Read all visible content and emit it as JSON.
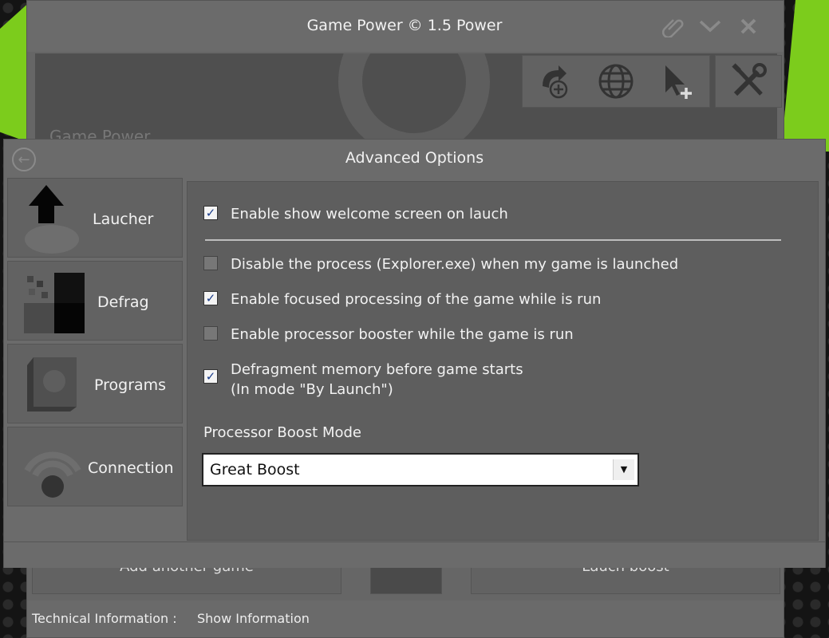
{
  "app": {
    "title": "Game Power © 1.5 Power",
    "banner_text": "Game Power"
  },
  "toolbar": {
    "icons": [
      "refresh-add-icon",
      "globe-icon",
      "cursor-add-icon",
      "tools-icon"
    ]
  },
  "window_controls": {
    "icons": [
      "attach-icon",
      "minimize-icon",
      "close-icon"
    ]
  },
  "bottom": {
    "add_game_label": "Add another game",
    "launch_boost_label": "Lauch boost"
  },
  "status": {
    "label": "Technical Information :",
    "link": "Show Information"
  },
  "dialog": {
    "title": "Advanced Options",
    "sidebar": [
      {
        "label": "Laucher",
        "icon": "launcher-arrow-icon"
      },
      {
        "label": "Defrag",
        "icon": "defrag-blocks-icon"
      },
      {
        "label": "Programs",
        "icon": "programs-box-icon"
      },
      {
        "label": "Connection",
        "icon": "wifi-icon"
      }
    ],
    "options": [
      {
        "label": "Enable show welcome screen on lauch",
        "checked": true
      },
      {
        "label": "Disable the process (Explorer.exe) when my game is launched",
        "checked": false
      },
      {
        "label": "Enable focused processing of the game while is run",
        "checked": true
      },
      {
        "label": "Enable processor booster while the game is run",
        "checked": false
      },
      {
        "label": "Defragment memory before game starts",
        "label2": "(In mode \"By Launch\")",
        "checked": true
      }
    ],
    "boost_mode": {
      "label": "Processor Boost Mode",
      "value": "Great Boost"
    }
  },
  "colors": {
    "accent_green": "#7ccc1c",
    "panel": "#6b6b6b",
    "content": "#5e5e5e"
  }
}
